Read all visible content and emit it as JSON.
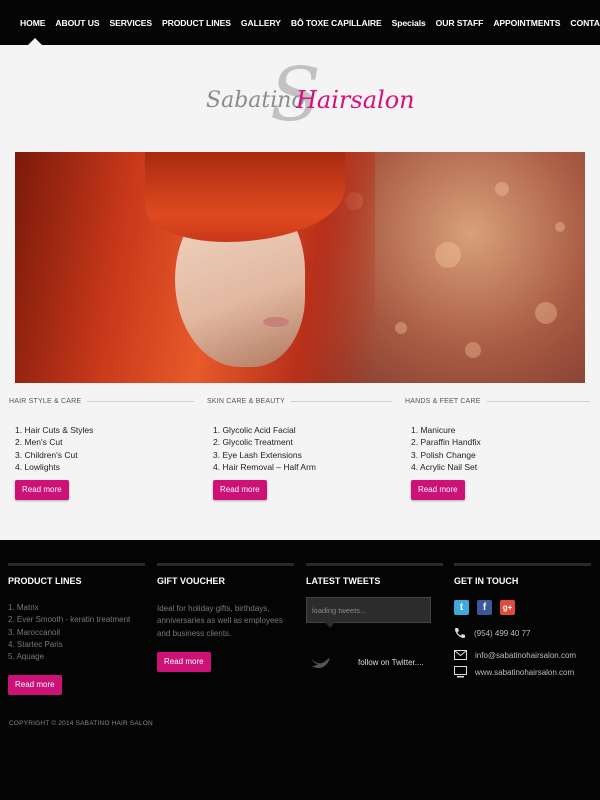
{
  "nav": {
    "items": [
      "HOME",
      "ABOUT US",
      "SERVICES",
      "PRODUCT LINES",
      "GALLERY",
      "BÔ TOXE CAPILLAIRE",
      "Specials",
      "OUR STAFF",
      "APPOINTMENTS",
      "CONTACT US"
    ]
  },
  "logo": {
    "part1": "Sabatino",
    "part2": "Hairsalon",
    "monogram": "S"
  },
  "services": [
    {
      "heading": "HAIR STYLE & CARE",
      "items": [
        "1. Hair Cuts & Styles",
        "2. Men's Cut",
        "3. Children's Cut",
        "4. Lowlights"
      ],
      "button": "Read more"
    },
    {
      "heading": "SKIN CARE & BEAUTY",
      "items": [
        "1. Glycolic Acid Facial",
        "2. Glycolic Treatment",
        "3. Eye Lash Extensions",
        "4. Hair Removal – Half Arm"
      ],
      "button": "Read more"
    },
    {
      "heading": "HANDS & FEET CARE",
      "items": [
        "1. Manicure",
        "2. Paraffin Handfix",
        "3. Polish Change",
        "4. Acrylic Nail Set"
      ],
      "button": "Read more"
    }
  ],
  "footer": {
    "product_lines": {
      "title": "PRODUCT LINES",
      "items": [
        "1. Matrix",
        "2. Ever Smooth - keratin treatment",
        "3. Maroccanoil",
        "4. Startec Paris",
        "5. Aquage"
      ],
      "button": "Read more"
    },
    "gift_voucher": {
      "title": "GIFT VOUCHER",
      "text": "Ideal for holiday gifts, birthdays, anniversaries as well as employees and business clients.",
      "button": "Read more"
    },
    "latest_tweets": {
      "title": "LATEST TWEETS",
      "loading": "loading tweets...",
      "follow": "follow on Twitter...."
    },
    "get_in_touch": {
      "title": "GET IN TOUCH",
      "phone": "(954) 499 40 77",
      "email": "info@sabatinohairsalon.com",
      "website": "www.sabatinohairsalon.com"
    },
    "copyright": "COPYRIGHT © 2014 SABATINO HAIR SALON"
  },
  "colors": {
    "accent": "#cc1177",
    "nav_bg": "#050505",
    "footer_bg": "#040404",
    "twitter": "#3ea9dd",
    "facebook": "#3b5998",
    "gplus": "#dd4b39"
  }
}
